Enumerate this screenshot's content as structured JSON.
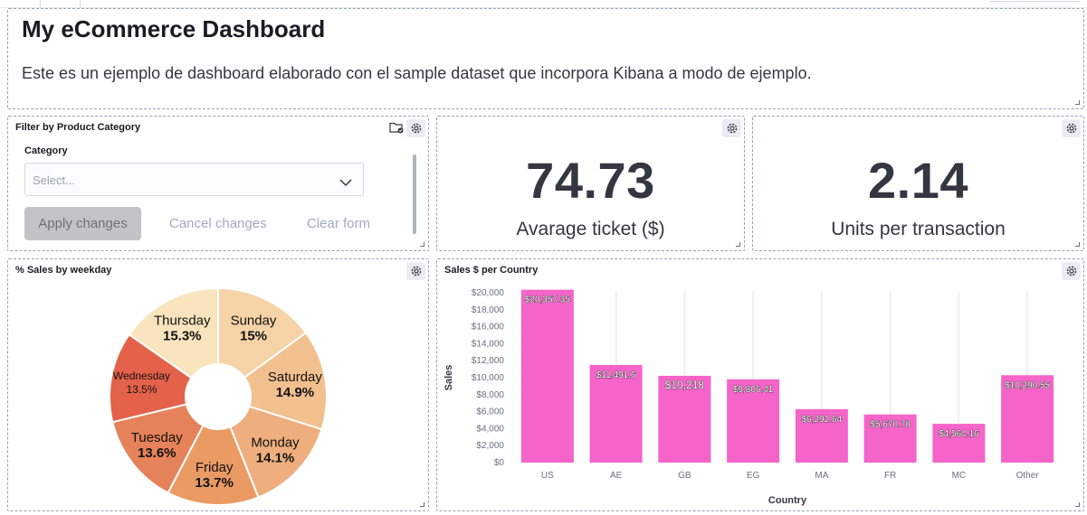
{
  "markdown": {
    "title": "My eCommerce Dashboard",
    "text": "Este es un ejemplo de dashboard elaborado con el sample dataset que incorpora Kibana a modo de ejemplo."
  },
  "filter": {
    "title": "Filter by Product Category",
    "category_label": "Category",
    "select_placeholder": "Select...",
    "apply_label": "Apply changes",
    "cancel_label": "Cancel changes",
    "clear_label": "Clear form"
  },
  "metrics": [
    {
      "value": "74.73",
      "label": "Avarage ticket ($)"
    },
    {
      "value": "2.14",
      "label": "Units per transaction"
    }
  ],
  "pie": {
    "title": "% Sales by weekday"
  },
  "bar": {
    "title": "Sales $ per Country"
  },
  "chart_data": [
    {
      "type": "pie",
      "title": "% Sales by weekday",
      "donut": true,
      "slices": [
        {
          "label": "Sunday",
          "value": 15,
          "display": "15%",
          "color": "#f5d3a7"
        },
        {
          "label": "Saturday",
          "value": 14.9,
          "display": "14.9%",
          "color": "#f2c08e"
        },
        {
          "label": "Monday",
          "value": 14.1,
          "display": "14.1%",
          "color": "#eeae7d"
        },
        {
          "label": "Friday",
          "value": 13.7,
          "display": "13.7%",
          "color": "#ea9a63"
        },
        {
          "label": "Tuesday",
          "value": 13.6,
          "display": "13.6%",
          "color": "#e6825a"
        },
        {
          "label": "Wednesday",
          "value": 13.5,
          "display": "13.5%",
          "color": "#e4624a"
        },
        {
          "label": "Thursday",
          "value": 15.3,
          "display": "15.3%",
          "color": "#f9e4be"
        }
      ]
    },
    {
      "type": "bar",
      "title": "Sales $ per Country",
      "xlabel": "Country",
      "ylabel": "Sales",
      "ylim": [
        0,
        20000
      ],
      "yticks": [
        "$0",
        "$2,000",
        "$4,000",
        "$6,000",
        "$8,000",
        "$10,000",
        "$12,000",
        "$14,000",
        "$16,000",
        "$18,000",
        "$20,000"
      ],
      "categories": [
        "US",
        "AE",
        "GB",
        "EG",
        "MA",
        "FR",
        "MC",
        "Other"
      ],
      "values": [
        20357.35,
        11491.6,
        10218,
        9806.41,
        6292.64,
        5670.78,
        4564.16,
        10290.55
      ],
      "value_labels": [
        "$20,357.35",
        "$11,491.6",
        "$10,218",
        "$9,806.41",
        "$6,292.64",
        "$5,670.78",
        "$4,564.16",
        "$10,290.55"
      ],
      "color": "#f564c9",
      "grid": true
    }
  ]
}
